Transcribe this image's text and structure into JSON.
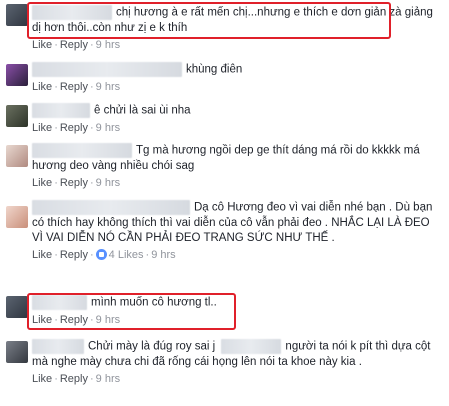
{
  "comments": [
    {
      "text": "chị hương à e rất mến chị...nhưng e thích e dơn giản zà giảng dị hơn thôi..còn như zị e k thíh",
      "actions": {
        "like": "Like",
        "reply": "Reply",
        "time": "9 hrs"
      }
    },
    {
      "text": "khùng điên",
      "actions": {
        "like": "Like",
        "reply": "Reply",
        "time": "9 hrs"
      }
    },
    {
      "text": "ê chửi là sai ùi nha",
      "actions": {
        "like": "Like",
        "reply": "Reply",
        "time": "9 hrs"
      }
    },
    {
      "text": "Tg mà hương ngồi dep ge thít dáng má rồi do kkkkk má hương deo vàng nhiều chói sag",
      "actions": {
        "like": "Like",
        "reply": "Reply",
        "time": "9 hrs"
      }
    },
    {
      "text": "Dạ cô Hương đeo vì vai diễn nhé bạn . Dù bạn có thích hay không thích thì vai diễn của cô vẫn phải đeo . NHẮC LẠI LÀ ĐEO VÌ VAI DIỄN NÓ CẦN PHẢI ĐEO TRANG SỨC NHƯ THẾ .",
      "actions": {
        "like": "Like",
        "reply": "Reply",
        "likes": "4 Likes",
        "time": "9 hrs"
      }
    },
    {
      "text": "mình muốn cô hương tl..",
      "actions": {
        "like": "Like",
        "reply": "Reply",
        "time": "9 hrs"
      }
    },
    {
      "text_a": "Chửi mày là đúg roy sai j",
      "text_b": "người ta nói k pít thì dựa cột mà nghe mày chưa chi đã rống cái họng lên nói ta khoe này kia .",
      "actions": {
        "like": "Like",
        "reply": "Reply",
        "time": "9 hrs"
      }
    }
  ],
  "icons": {
    "avatar": "avatar",
    "like": "like-icon"
  },
  "colors": {
    "highlight": "#e0202a",
    "meta": "#90949c"
  }
}
